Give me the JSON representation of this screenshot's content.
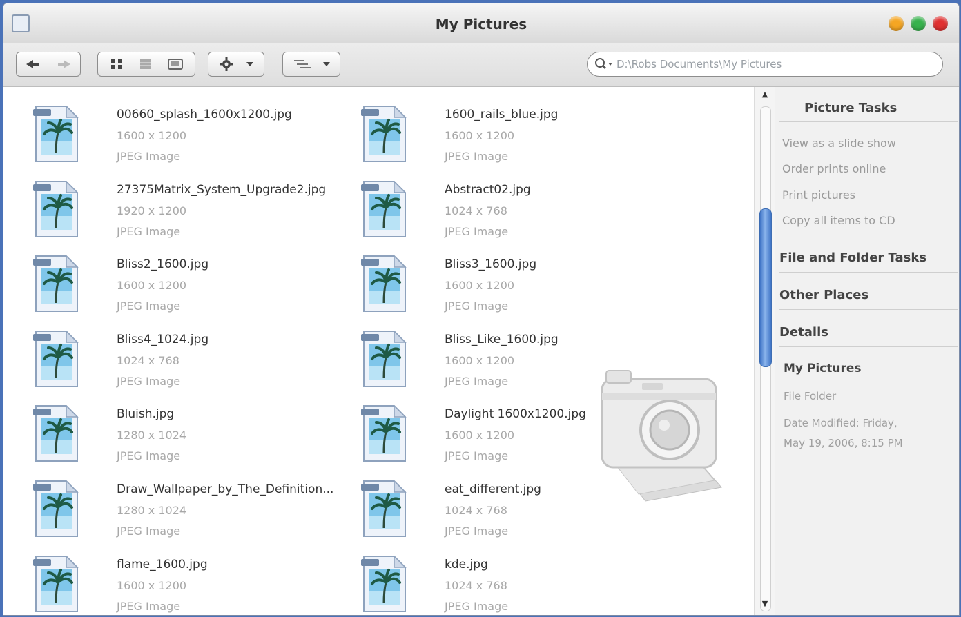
{
  "window": {
    "title": "My Pictures",
    "buttons": {
      "minimize_color": "#f5a623",
      "maximize_color": "#37b24d",
      "close_color": "#e03131"
    }
  },
  "toolbar": {
    "back_icon": "back-arrow-icon",
    "forward_icon": "forward-arrow-icon",
    "view_icons": [
      "icons-view-icon",
      "list-view-icon",
      "thumbnail-view-icon"
    ],
    "actions_icon": "gear-icon",
    "arrange_icon": "arrange-lines-icon",
    "search_icon": "magnifier-icon",
    "search_placeholder": "D:\\Robs Documents\\My Pictures"
  },
  "files": [
    {
      "name": "00660_splash_1600x1200.jpg",
      "dimensions": "1600 x 1200",
      "type": "JPEG Image"
    },
    {
      "name": "1600_rails_blue.jpg",
      "dimensions": "1600 x 1200",
      "type": "JPEG Image"
    },
    {
      "name": "27375Matrix_System_Upgrade2.jpg",
      "dimensions": "1920 x 1200",
      "type": "JPEG Image"
    },
    {
      "name": "Abstract02.jpg",
      "dimensions": "1024 x 768",
      "type": "JPEG Image"
    },
    {
      "name": "Bliss2_1600.jpg",
      "dimensions": "1600 x 1200",
      "type": "JPEG Image"
    },
    {
      "name": "Bliss3_1600.jpg",
      "dimensions": "1600 x 1200",
      "type": "JPEG Image"
    },
    {
      "name": "Bliss4_1024.jpg",
      "dimensions": "1024 x 768",
      "type": "JPEG Image"
    },
    {
      "name": "Bliss_Like_1600.jpg",
      "dimensions": "1600 x 1200",
      "type": "JPEG Image"
    },
    {
      "name": "Bluish.jpg",
      "dimensions": "1280 x 1024",
      "type": "JPEG Image"
    },
    {
      "name": "Daylight 1600x1200.jpg",
      "dimensions": "1600 x 1200",
      "type": "JPEG Image"
    },
    {
      "name": "Draw_Wallpaper_by_The_Definition...",
      "dimensions": "1280 x 1024",
      "type": "JPEG Image"
    },
    {
      "name": "eat_different.jpg",
      "dimensions": "1024 x 768",
      "type": "JPEG Image"
    },
    {
      "name": "flame_1600.jpg",
      "dimensions": "1600 x 1200",
      "type": "JPEG Image"
    },
    {
      "name": "kde.jpg",
      "dimensions": "1024 x 768",
      "type": "JPEG Image"
    }
  ],
  "side_panel": {
    "picture_tasks": {
      "title": "Picture Tasks",
      "items": [
        "View as a slide show",
        "Order prints online",
        "Print pictures",
        "Copy all items to CD"
      ]
    },
    "file_folder_tasks": "File and Folder Tasks",
    "other_places": "Other Places",
    "details": {
      "title": "Details",
      "name": "My Pictures",
      "kind": "File Folder",
      "modified_line1": "Date Modified: Friday,",
      "modified_line2": "May 19, 2006, 8:15 PM"
    }
  },
  "scrollbar": {
    "up_arrow": "▲",
    "down_arrow": "▼",
    "position_fraction": 0.3
  },
  "icons": {
    "file_icon": "jpeg-palm-tree-icon",
    "folder_watermark": "camera-icon"
  }
}
